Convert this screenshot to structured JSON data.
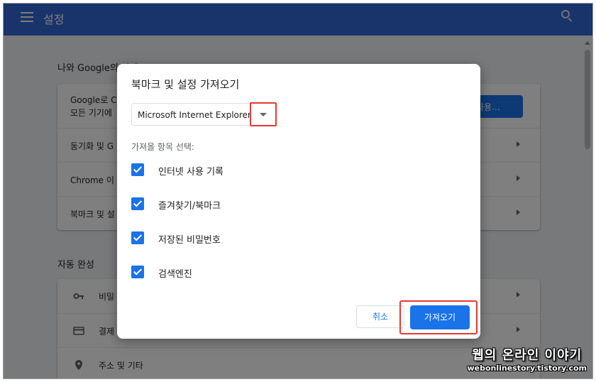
{
  "header": {
    "title": "설정"
  },
  "background": {
    "section_you_google": "나와 Google의 관계",
    "signin_line1": "Google로 C",
    "signin_line2": "모든 기기에",
    "sync_button": "사용...",
    "rows": [
      {
        "label": "동기화 및 G"
      },
      {
        "label": "Chrome 이"
      },
      {
        "label": "북마크 및 설"
      }
    ],
    "section_autofill": "자동 완성",
    "autofill_rows": [
      {
        "label": "비밀",
        "icon": "key-icon"
      },
      {
        "label": "결제",
        "icon": "credit-card-icon"
      },
      {
        "label": "주소 및 기타",
        "icon": "location-pin-icon"
      }
    ]
  },
  "dialog": {
    "title": "북마크 및 설정 가져오기",
    "browser_select_value": "Microsoft Internet Explorer",
    "items_label": "가져올 항목 선택:",
    "items": [
      {
        "label": "인터넷 사용 기록",
        "checked": true
      },
      {
        "label": "즐겨찾기/북마크",
        "checked": true
      },
      {
        "label": "저장된 비밀번호",
        "checked": true
      },
      {
        "label": "검색엔진",
        "checked": true
      }
    ],
    "cancel_label": "취소",
    "import_label": "가져오기"
  },
  "watermark": {
    "main": "웹의 온라인 이야기",
    "sub": "webonlinestory.tistory.com"
  },
  "colors": {
    "header": "#3367d6",
    "accent": "#1a73e8",
    "highlight": "#e53935"
  }
}
